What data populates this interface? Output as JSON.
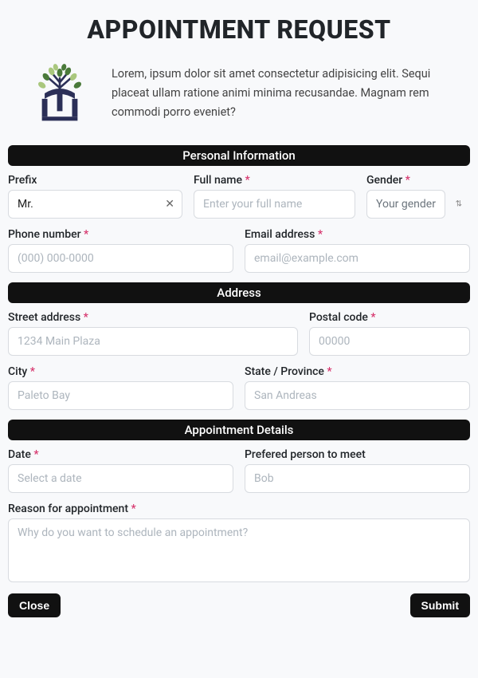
{
  "title": "APPOINTMENT REQUEST",
  "intro": "Lorem, ipsum dolor sit amet consectetur adipisicing elit. Sequi placeat ullam ratione animi minima recusandae. Magnam rem commodi porro eveniet?",
  "sections": {
    "personal": "Personal Information",
    "address": "Address",
    "details": "Appointment Details"
  },
  "fields": {
    "prefix": {
      "label": "Prefix",
      "value": "Mr."
    },
    "fullname": {
      "label": "Full name",
      "placeholder": "Enter your full name",
      "required": true
    },
    "gender": {
      "label": "Gender",
      "placeholder": "Your gender",
      "required": true
    },
    "phone": {
      "label": "Phone number",
      "placeholder": "(000) 000-0000",
      "required": true
    },
    "email": {
      "label": "Email address",
      "placeholder": "email@example.com",
      "required": true
    },
    "street": {
      "label": "Street address",
      "placeholder": "1234 Main Plaza",
      "required": true
    },
    "postal": {
      "label": "Postal code",
      "placeholder": "00000",
      "required": true
    },
    "city": {
      "label": "City",
      "placeholder": "Paleto Bay",
      "required": true
    },
    "state": {
      "label": "State / Province",
      "placeholder": "San Andreas",
      "required": true
    },
    "date": {
      "label": "Date",
      "placeholder": "Select a date",
      "required": true
    },
    "person": {
      "label": "Prefered person to meet",
      "placeholder": "Bob"
    },
    "reason": {
      "label": "Reason for appointment",
      "placeholder": "Why do you want to schedule an appointment?",
      "required": true
    }
  },
  "buttons": {
    "close": "Close",
    "submit": "Submit"
  },
  "required_mark": "*"
}
